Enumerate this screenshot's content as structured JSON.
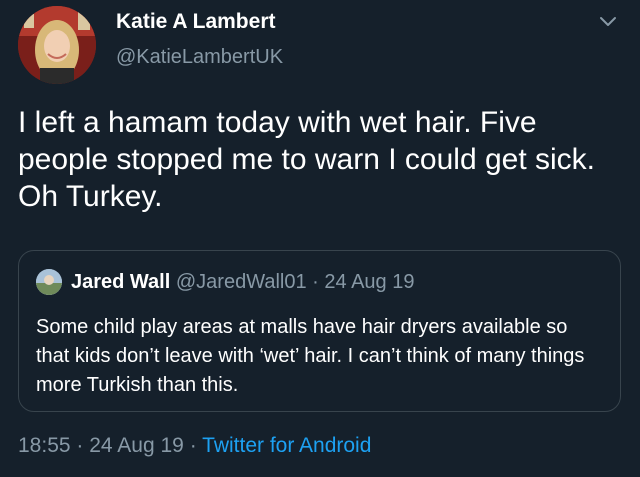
{
  "author": {
    "display_name": "Katie A Lambert",
    "handle": "@KatieLambertUK"
  },
  "tweet": {
    "text": "I left a hamam today with wet hair. Five people stopped me to warn I could get sick. Oh Turkey."
  },
  "quote": {
    "display_name": "Jared Wall",
    "handle": "@JaredWall01",
    "separator": "·",
    "date": "24 Aug 19",
    "text": "Some child play areas at malls have hair dryers available so that kids don’t leave with ‘wet’ hair. I can’t think of many things more Turkish than this."
  },
  "meta": {
    "time": "18:55",
    "separator": "·",
    "date": "24 Aug 19",
    "source": "Twitter for Android"
  },
  "icons": {
    "menu": "chevron-down-icon"
  },
  "colors": {
    "background": "#15202b",
    "muted": "#8899a6",
    "link": "#1da1f2",
    "border": "#38444d"
  }
}
